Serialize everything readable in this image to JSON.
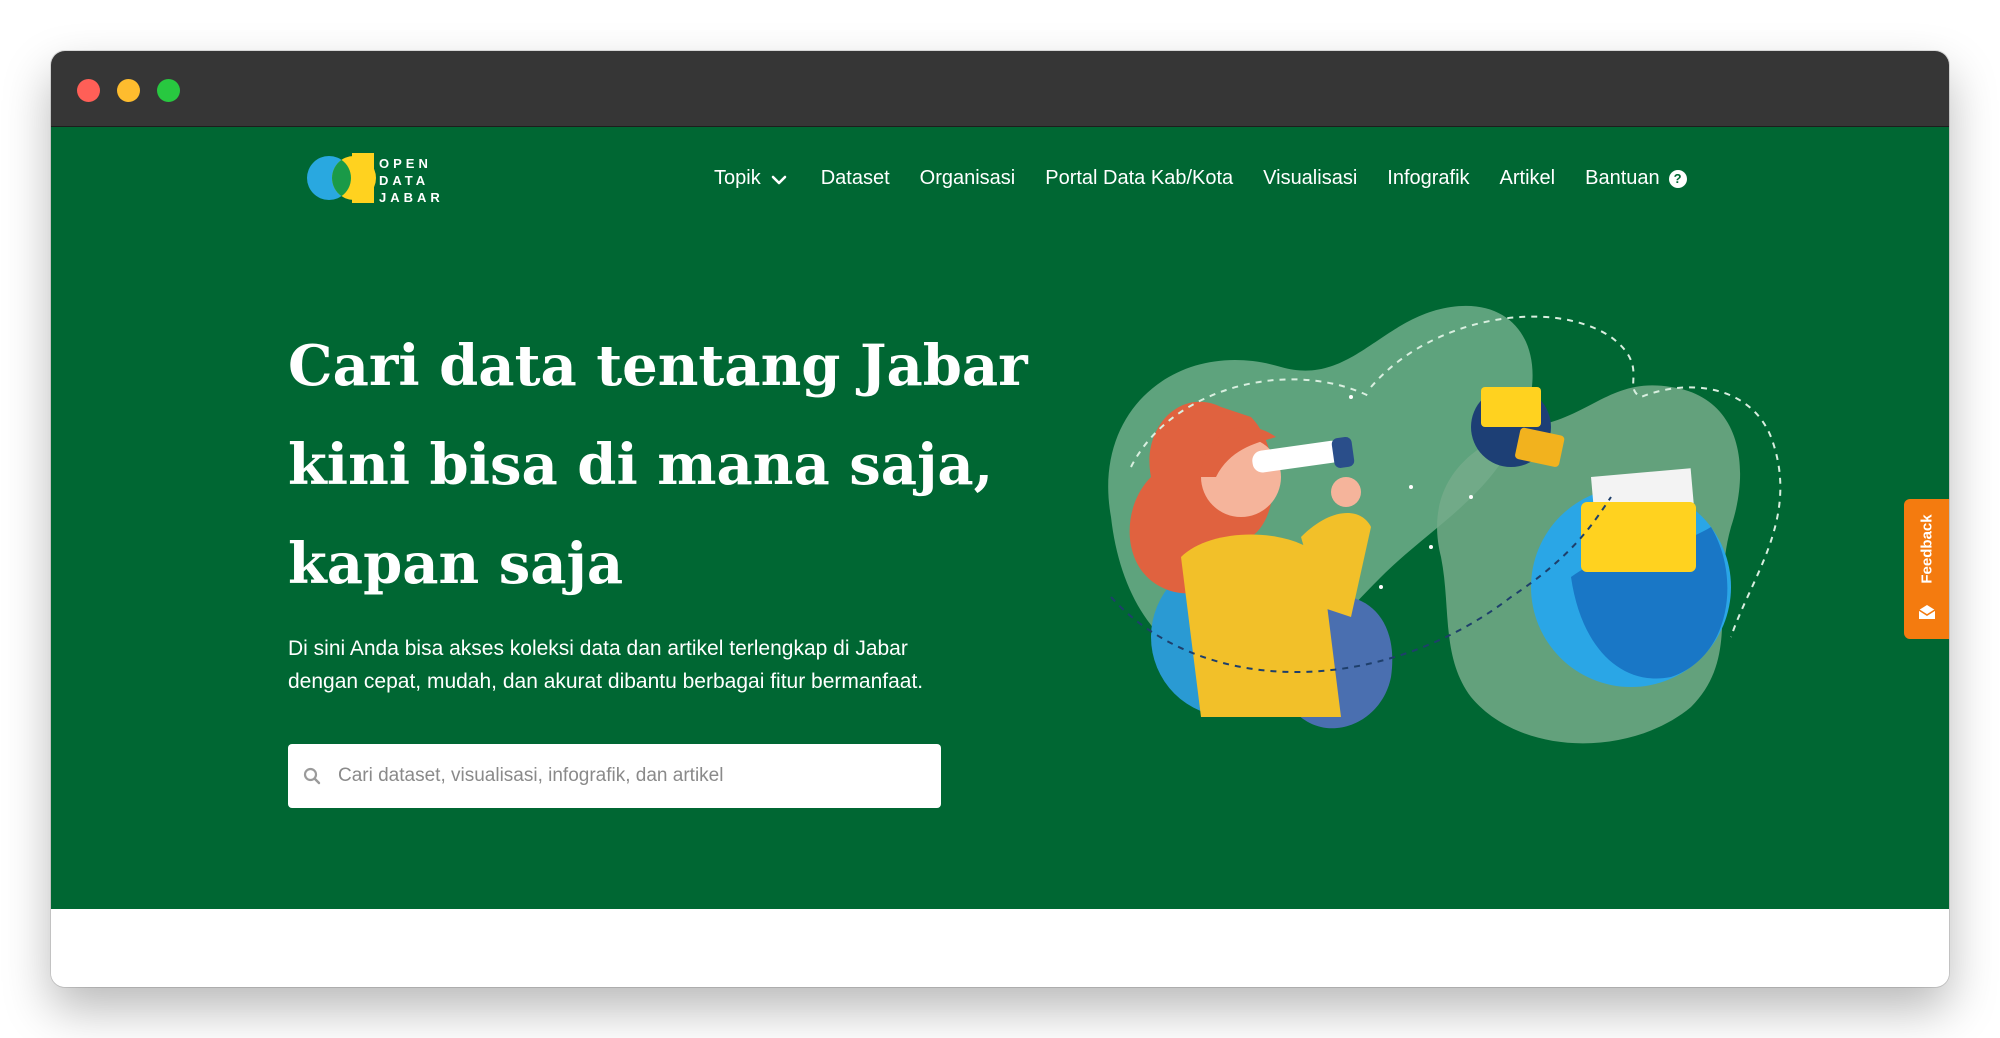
{
  "brand": {
    "logo_lines": [
      "OPEN",
      "DATA",
      "JABAR"
    ]
  },
  "nav": {
    "items": [
      {
        "label": "Topik",
        "has_dropdown": true
      },
      {
        "label": "Dataset"
      },
      {
        "label": "Organisasi"
      },
      {
        "label": "Portal Data Kab/Kota"
      },
      {
        "label": "Visualisasi"
      },
      {
        "label": "Infografik"
      },
      {
        "label": "Artikel"
      },
      {
        "label": "Bantuan",
        "icon": "help-circle-icon"
      }
    ]
  },
  "hero": {
    "headline_lines": [
      "Cari data tentang Jabar",
      "kini bisa di mana saja,",
      "kapan saja"
    ],
    "subtext_lines": [
      "Di sini Anda bisa akses koleksi data dan artikel terlengkap di Jabar",
      "dengan cepat, mudah, dan akurat dibantu berbagai fitur bermanfaat."
    ]
  },
  "search": {
    "placeholder": "Cari dataset, visualisasi, infografik, dan artikel",
    "value": "",
    "icon": "search-icon"
  },
  "feedback": {
    "label": "Feedback",
    "icon": "mail-icon"
  },
  "colors": {
    "hero_background": "#006733",
    "feedback_tab": "#f47b0f",
    "logo_blue": "#29a8e0",
    "logo_green": "#1a9a48",
    "logo_yellow": "#ffd21f",
    "titlebar": "#363636"
  }
}
